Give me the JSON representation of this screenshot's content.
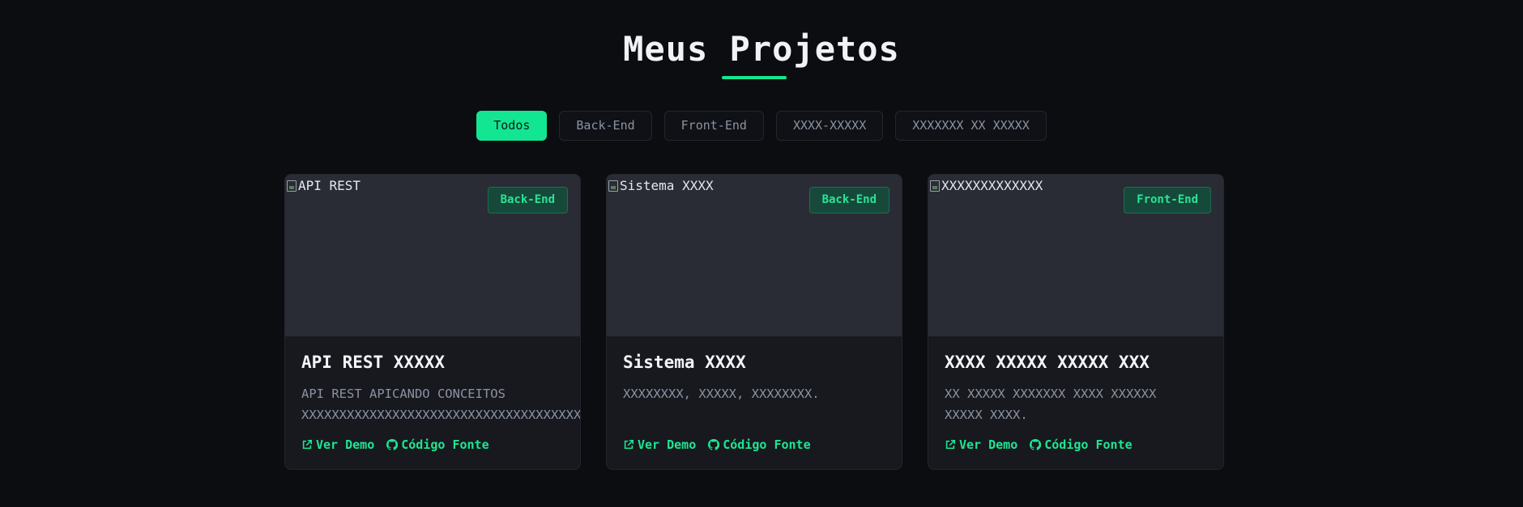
{
  "header": {
    "title": "Meus Projetos"
  },
  "filters": [
    {
      "label": "Todos",
      "active": true
    },
    {
      "label": "Back-End",
      "active": false
    },
    {
      "label": "Front-End",
      "active": false
    },
    {
      "label": "XXXX-XXXXX",
      "active": false
    },
    {
      "label": "XXXXXXX XX XXXXX",
      "active": false
    }
  ],
  "projects": [
    {
      "image_alt": "API REST",
      "badge": "Back-End",
      "title": "API REST XXXXX",
      "description": "API REST APICANDO CONCEITOS\nXXXXXXXXXXXXXXXXXXXXXXXXXXXXXXXXXXXXX",
      "demo_label": "Ver Demo",
      "source_label": "Código Fonte"
    },
    {
      "image_alt": "Sistema XXXX",
      "badge": "Back-End",
      "title": "Sistema XXXX",
      "description": "XXXXXXXX, XXXXX, XXXXXXXX.",
      "demo_label": "Ver Demo",
      "source_label": "Código Fonte"
    },
    {
      "image_alt": "XXXXXXXXXXXXX",
      "badge": "Front-End",
      "title": "XXXX XXXXX XXXXX XXX",
      "description": "XX XXXXX XXXXXXX XXXX XXXXXX\nXXXXX XXXX.",
      "demo_label": "Ver Demo",
      "source_label": "Código Fonte"
    }
  ],
  "icons": {
    "external_link": "external-link-icon",
    "github": "github-icon",
    "broken_image": "broken-image-icon"
  },
  "colors": {
    "background": "#0c0d11",
    "accent": "#12e692",
    "card": "#17191e",
    "badge_bg": "#16493a"
  }
}
